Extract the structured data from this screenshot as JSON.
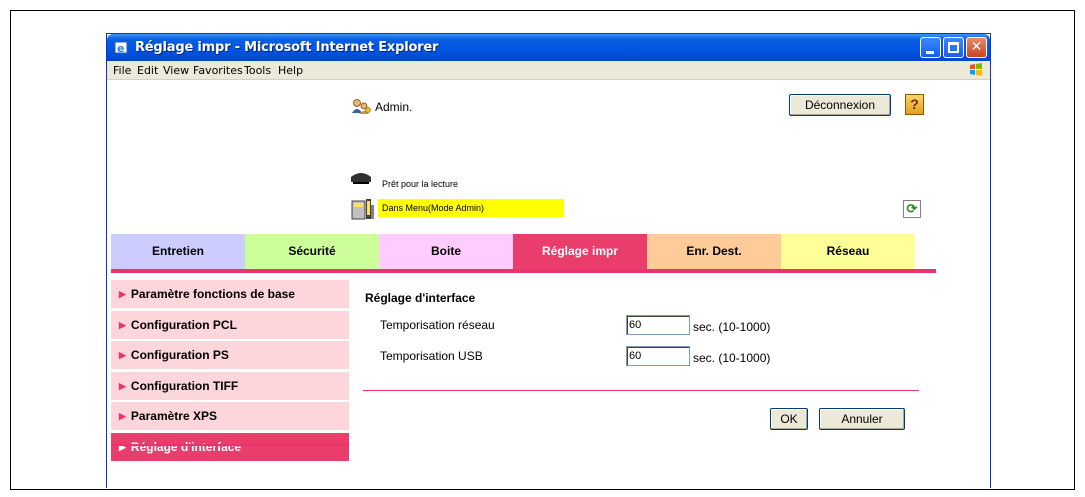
{
  "window": {
    "title": "Réglage impr - Microsoft Internet Explorer"
  },
  "menu": [
    "File",
    "Edit",
    "View",
    "Favorites",
    "Tools",
    "Help"
  ],
  "header": {
    "user_label": "Admin.",
    "logout_label": "Déconnexion",
    "help_label": "?",
    "status_ready": "Prêt pour la lecture",
    "status_mode": "Dans Menu(Mode Admin)"
  },
  "tabs": [
    {
      "label": "Entretien",
      "color": "#ccccff"
    },
    {
      "label": "Sécurité",
      "color": "#ccff99"
    },
    {
      "label": "Boite",
      "color": "#ffccff"
    },
    {
      "label": "Réglage impr",
      "color": "#ea3d6b",
      "active": true
    },
    {
      "label": "Enr. Dest.",
      "color": "#ffcc99"
    },
    {
      "label": "Réseau",
      "color": "#ffff99"
    }
  ],
  "sidebar": {
    "items": [
      {
        "label": "Paramètre fonctions de base"
      },
      {
        "label": "Configuration PCL"
      },
      {
        "label": "Configuration PS"
      },
      {
        "label": "Configuration TIFF"
      },
      {
        "label": "Paramètre XPS"
      },
      {
        "label": "Réglage d'interface",
        "active": true
      }
    ]
  },
  "main": {
    "title": "Réglage d'interface",
    "fields": [
      {
        "label": "Temporisation réseau",
        "value": "60",
        "hint": "sec. (10-1000)"
      },
      {
        "label": "Temporisation USB",
        "value": "60",
        "hint": "sec. (10-1000)"
      }
    ],
    "ok_label": "OK",
    "cancel_label": "Annuler"
  },
  "colors": {
    "accent": "#e8336d",
    "sidebar_bg": "#fcd6da",
    "status_highlight": "#ffff00",
    "titlebar": "#0054e3"
  }
}
